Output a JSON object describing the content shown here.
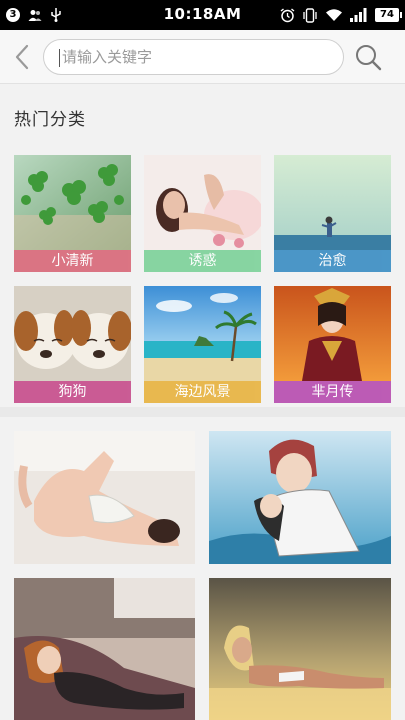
{
  "status_bar": {
    "time": "10:18AM",
    "notification_count": "3",
    "battery": "74",
    "icons": [
      "contacts-icon",
      "usb-icon",
      "alarm-icon",
      "vibrate-icon",
      "wifi-icon",
      "signal-icon",
      "battery-icon"
    ]
  },
  "search": {
    "placeholder": "请输入关键字",
    "value": "",
    "back_icon": "chevron-left-icon",
    "search_icon": "search-icon"
  },
  "categories": {
    "title": "热门分类",
    "items": [
      {
        "label": "小清新",
        "label_color": "#d96a7a"
      },
      {
        "label": "诱惑",
        "label_color": "#7fd29b"
      },
      {
        "label": "治愈",
        "label_color": "#3d8fc4"
      },
      {
        "label": "狗狗",
        "label_color": "#c74f8d"
      },
      {
        "label": "海边风景",
        "label_color": "#e8b442"
      },
      {
        "label": "芈月传",
        "label_color": "#b84fb0"
      }
    ]
  },
  "colors": {
    "status_bar_bg": "#000000",
    "header_bg": "#f7f7f7",
    "page_bg": "#f2f2f2"
  }
}
